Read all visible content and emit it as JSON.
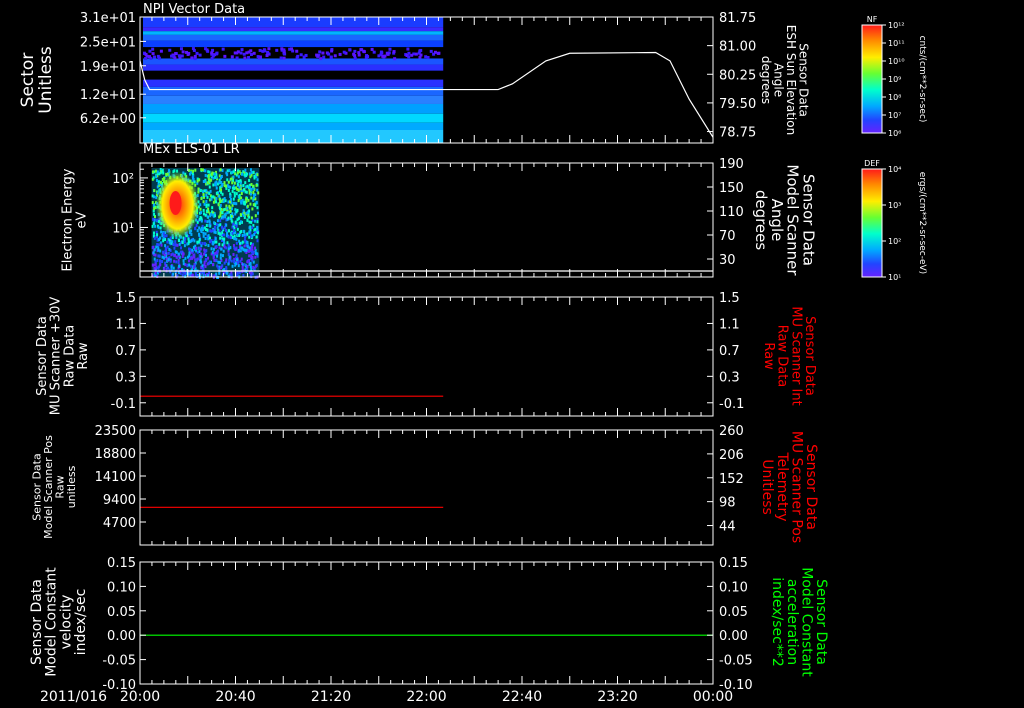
{
  "date_label": "2011/016",
  "x_ticks": [
    "20:00",
    "20:40",
    "21:20",
    "22:00",
    "22:40",
    "23:20",
    "00:00"
  ],
  "colors": {
    "background": "#000000",
    "axis": "#ffffff",
    "red": "#ff0000",
    "green": "#00ff00",
    "spec_gradient": [
      "#ff1a1a",
      "#ff8800",
      "#ffee00",
      "#66ff33",
      "#00ffcc",
      "#00aaff",
      "#2244ff",
      "#6622ff"
    ]
  },
  "colorbars": [
    {
      "tag": "NF",
      "units": "cnts/(cm**2-sr-sec)",
      "ticks": [
        "10¹²",
        "10¹¹",
        "10¹⁰",
        "10⁹",
        "10⁸",
        "10⁷",
        "10⁶"
      ]
    },
    {
      "tag": "DEF",
      "units": "ergs/(cm**2-sr-sec-eV)",
      "ticks": [
        "10⁴",
        "10³",
        "10²",
        "10¹"
      ]
    }
  ],
  "chart_data": [
    {
      "type": "heatmap",
      "title": "NPI Vector Data",
      "ylabel": [
        "Sector",
        "Unitless"
      ],
      "yticks": [
        "3.1e+01",
        "2.5e+01",
        "1.9e+01",
        "1.2e+01",
        "6.2e+00"
      ],
      "ylim": [
        0,
        31
      ],
      "time_range": [
        "20:00",
        "22:07"
      ],
      "line": {
        "ylabel": [
          "Sensor Data",
          "ESH Sun Elevation",
          "Angle",
          "degrees"
        ],
        "yticks": [
          "81.75",
          "81.00",
          "80.25",
          "79.50",
          "78.75"
        ],
        "ylim": [
          78.45,
          81.75
        ],
        "points": [
          [
            "20:00",
            80.6
          ],
          [
            "20:02",
            80.1
          ],
          [
            "20:04",
            79.85
          ],
          [
            "20:30",
            79.85
          ],
          [
            "22:30",
            79.85
          ],
          [
            "22:36",
            80.0
          ],
          [
            "22:50",
            80.6
          ],
          [
            "23:00",
            80.8
          ],
          [
            "23:36",
            80.82
          ],
          [
            "23:42",
            80.6
          ],
          [
            "23:50",
            79.6
          ],
          [
            "00:00",
            78.6
          ]
        ]
      }
    },
    {
      "type": "heatmap",
      "title": "MEx ELS-01 LR",
      "ylabel": [
        "Electron Energy",
        "eV"
      ],
      "yticks": [
        "10²",
        "10¹"
      ],
      "ylim": [
        1,
        200
      ],
      "time_range": [
        "20:04",
        "20:50"
      ],
      "line": {
        "ylabel": [
          "Sensor Data",
          "Model Scanner",
          "Angle",
          "degrees"
        ],
        "yticks": [
          "190",
          "150",
          "110",
          "70",
          "30"
        ],
        "ylim": [
          0,
          190
        ],
        "constant": 10
      }
    },
    {
      "type": "line",
      "ylabel": [
        "Sensor Data",
        "MU Scanner +30V",
        "Raw Data",
        "Raw"
      ],
      "yticks": [
        "1.5",
        "1.1",
        "0.7",
        "0.3",
        "-0.1"
      ],
      "ylim": [
        -0.3,
        1.5
      ],
      "series": [
        {
          "color": "#ff0000",
          "x": [
            "20:00",
            "22:07"
          ],
          "values": [
            0,
            0
          ]
        }
      ],
      "right": {
        "ylabel": [
          "Sensor Data",
          "MU Scanner Int",
          "Raw Data",
          "Raw"
        ],
        "yticks": [
          "1.5",
          "1.1",
          "0.7",
          "0.3",
          "-0.1"
        ],
        "color": "#ff0000"
      }
    },
    {
      "type": "line",
      "ylabel": [
        "Sensor Data",
        "Model Scanner Pos",
        "Raw",
        "unitless"
      ],
      "yticks": [
        "23500",
        "18800",
        "14100",
        "9400",
        "4700"
      ],
      "ylim": [
        0,
        23500
      ],
      "series": [
        {
          "color": "#ff0000",
          "x": [
            "20:00",
            "22:07"
          ],
          "values": [
            7700,
            7700
          ]
        }
      ],
      "right": {
        "ylabel": [
          "Sensor Data",
          "MU Scanner Pos",
          "Telemetry",
          "Unitless"
        ],
        "yticks": [
          "260",
          "206",
          "152",
          "98",
          "44"
        ],
        "color": "#ff0000"
      }
    },
    {
      "type": "line",
      "ylabel": [
        "Sensor Data",
        "Model Constant",
        "velocity",
        "index/sec"
      ],
      "yticks": [
        "0.15",
        "0.10",
        "0.05",
        "0.00",
        "-0.05",
        "-0.10"
      ],
      "ylim": [
        -0.1,
        0.15
      ],
      "series": [
        {
          "color": "#00ff00",
          "x": [
            "20:00",
            "00:00"
          ],
          "values": [
            0,
            0
          ]
        }
      ],
      "right": {
        "ylabel": [
          "Sensor Data",
          "Model Constant",
          "acceleration",
          "index/sec**2"
        ],
        "yticks": [
          "0.15",
          "0.10",
          "0.05",
          "0.00",
          "-0.05",
          "-0.10"
        ],
        "color": "#00ff00"
      }
    }
  ]
}
